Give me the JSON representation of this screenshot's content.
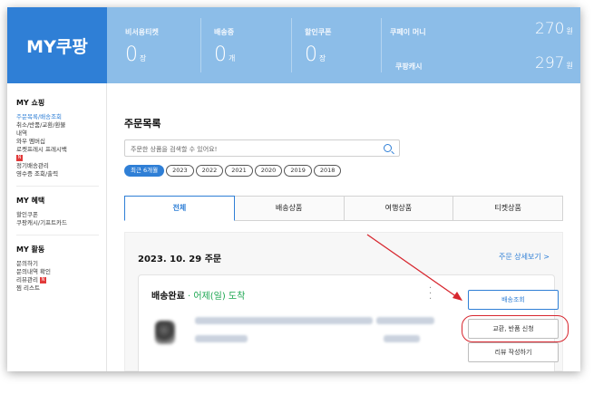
{
  "header": {
    "logo": "MY쿠팡",
    "stats": [
      {
        "label": "비서용티켓",
        "value": "0",
        "unit": "장"
      },
      {
        "label": "배송중",
        "value": "0",
        "unit": "개"
      },
      {
        "label": "할인쿠폰",
        "value": "0",
        "unit": "장"
      }
    ],
    "coupay": {
      "label": "쿠페이 머니",
      "value": "270",
      "unit": "원"
    },
    "cash": {
      "label": "쿠팡캐시",
      "value": "297",
      "unit": "원"
    }
  },
  "sidebar": {
    "sections": [
      {
        "title": "MY 쇼핑",
        "items": [
          {
            "label": "주문목록/배송조회",
            "active": true
          },
          {
            "label": "취소/반품/교환/환불"
          },
          {
            "label": "내역"
          },
          {
            "label": "와우 멤버십"
          },
          {
            "label": "로켓프레시 프레시백"
          },
          {
            "label": "",
            "badge": "N"
          },
          {
            "label": "정기배송관리"
          },
          {
            "label": "영수증 조회/출력"
          }
        ]
      },
      {
        "title": "MY 혜택",
        "items": [
          {
            "label": "할인쿠폰"
          },
          {
            "label": "쿠팡캐시/기프트카드"
          }
        ]
      },
      {
        "title": "MY 활동",
        "items": [
          {
            "label": "문의하기"
          },
          {
            "label": "문의내역 확인"
          },
          {
            "label": "리뷰관리",
            "badge": "N"
          },
          {
            "label": "찜 리스트"
          }
        ]
      }
    ]
  },
  "main": {
    "title": "주문목록",
    "search": {
      "placeholder": "주문한 상품을 검색할 수 있어요!"
    },
    "year_filters": [
      "최근 6개월",
      "2023",
      "2022",
      "2021",
      "2020",
      "2019",
      "2018"
    ],
    "tabs": [
      "전체",
      "배송상품",
      "여행상품",
      "티켓상품"
    ],
    "order": {
      "date": "2023. 10. 29 주문",
      "detail_link": "주문 상세보기 >",
      "status": "배송완료",
      "eta": " · 어제(일) 도착",
      "buttons": [
        "배송조회",
        "교환, 반품 신청",
        "리뷰 작성하기"
      ]
    }
  },
  "colors": {
    "brand": "#2f7fd6",
    "header_bg": "#8cbde8",
    "eta": "#19a54f",
    "highlight": "#d7262e"
  }
}
